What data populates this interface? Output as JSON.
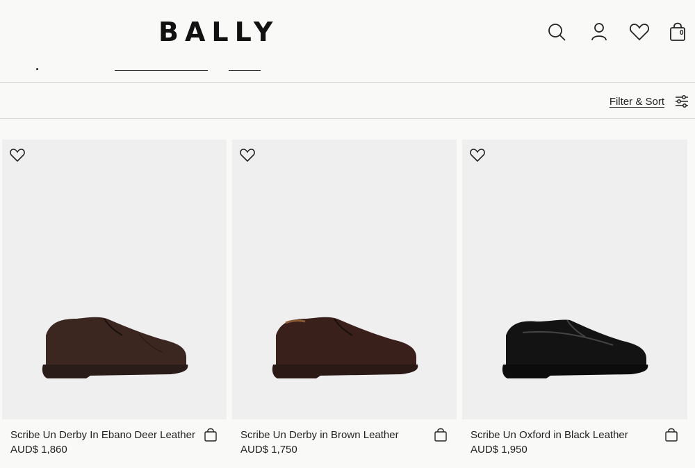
{
  "header": {
    "logo": "BALLY",
    "icons": [
      "search-icon",
      "account-icon",
      "wishlist-icon",
      "shopping-bag-icon"
    ],
    "cart_count": "0"
  },
  "toolbar": {
    "filter_label": "Filter & Sort",
    "filter_icon": "sliders-icon"
  },
  "products": [
    {
      "name": "Scribe Un Derby In Ebano Deer Leather",
      "price": "AUD$ 1,860",
      "shoe_color": "#3b2620"
    },
    {
      "name": "Scribe Un Derby in Brown Leather",
      "price": "AUD$ 1,750",
      "shoe_color": "#3a201b"
    },
    {
      "name": "Scribe Un Oxford in Black Leather",
      "price": "AUD$ 1,950",
      "shoe_color": "#131313"
    }
  ],
  "colors": {
    "background": "#f9f9f8",
    "card_background": "#efefef",
    "divider": "#d6d6d6",
    "text": "#1a1a1a"
  }
}
